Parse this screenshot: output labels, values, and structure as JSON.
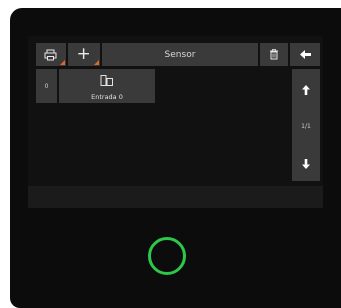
{
  "toolbar": {
    "printer_icon": "printer-icon",
    "add_label": "+",
    "title": "Sensor",
    "delete_icon": "trash-icon",
    "back_icon": "arrow-left-icon"
  },
  "cells": [
    {
      "index": "0",
      "icon": "door-sensor-icon",
      "label": "Entrada 0"
    }
  ],
  "side_panel": {
    "up_icon": "arrow-up-icon",
    "page_indicator": "1/1",
    "down_icon": "arrow-down-icon"
  },
  "colors": {
    "accent_marker": "#e0662a",
    "home_ring": "#2cc84a",
    "button_bg": "#3a3a3a",
    "screen_bg": "#111111"
  }
}
